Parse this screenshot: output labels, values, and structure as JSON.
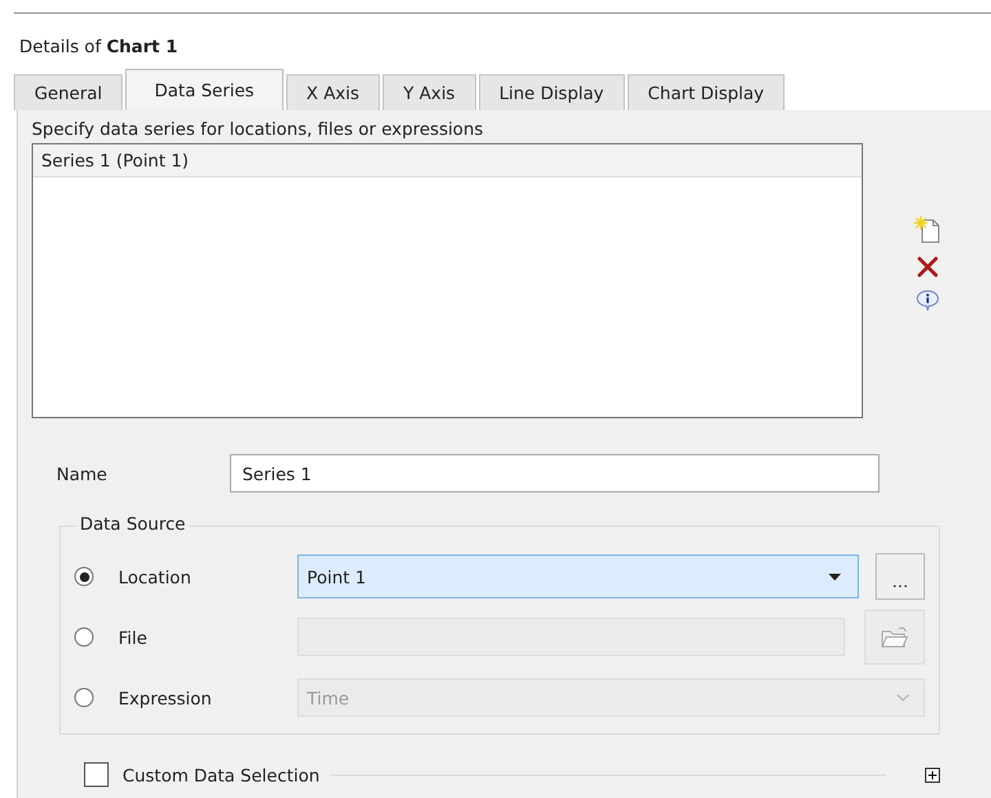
{
  "dialog": {
    "title": "Details of **Chart 1**"
  },
  "tabs": [
    {
      "label": "General",
      "selected": false
    },
    {
      "label": "Data Series",
      "selected": true
    },
    {
      "label": "X Axis",
      "selected": false
    },
    {
      "label": "Y Axis",
      "selected": false
    },
    {
      "label": "Line Display",
      "selected": false
    },
    {
      "label": "Chart Display",
      "selected": false
    }
  ],
  "description": "Specify data series for locations, files or expressions",
  "series_list": [
    {
      "label": "Series 1 (Point 1)",
      "selected": true
    }
  ],
  "name_field": {
    "label": "Name",
    "value": "Series 1"
  },
  "data_source": {
    "legend": "Data Source",
    "options": [
      {
        "label": "Location",
        "selected": true,
        "kind": "dropdown",
        "value": "Point 1",
        "disabled": false
      },
      {
        "label": "File",
        "selected": false,
        "kind": "file",
        "disabled": true
      },
      {
        "label": "Expression",
        "selected": false,
        "kind": "combo",
        "value": "Time",
        "disabled": true
      }
    ]
  },
  "custom_selection": {
    "label": "Custom Data Selection",
    "checked": false,
    "expanded": false
  }
}
